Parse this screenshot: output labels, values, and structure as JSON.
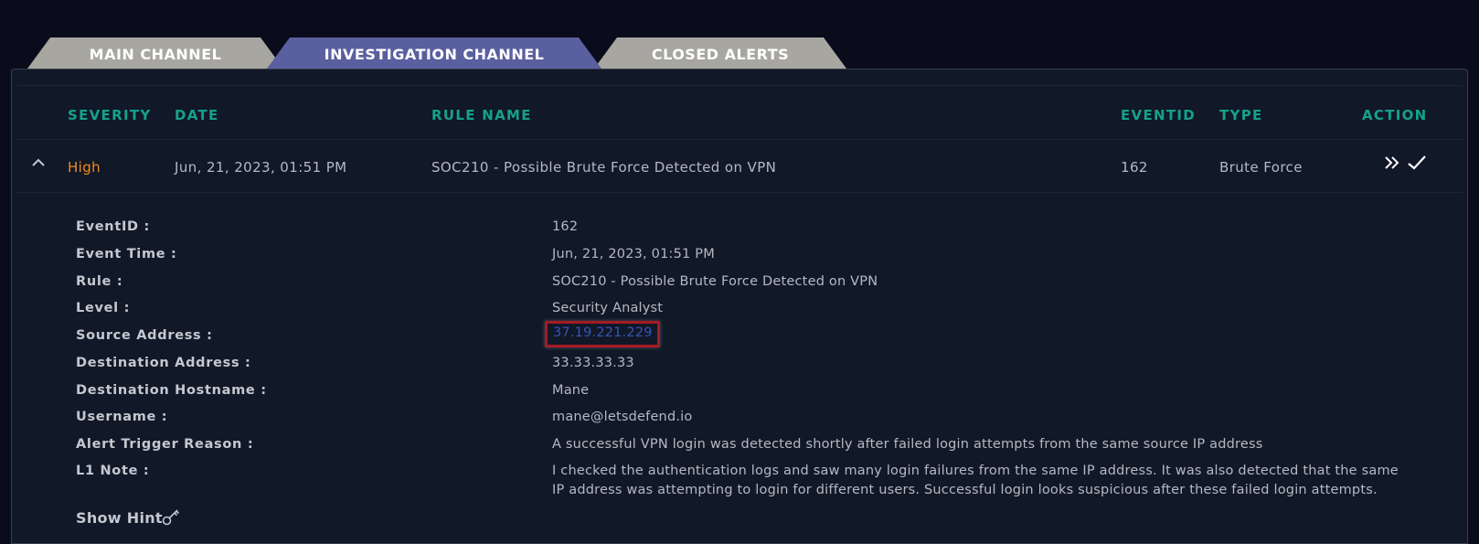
{
  "tabs": [
    {
      "label": "MAIN CHANNEL"
    },
    {
      "label": "INVESTIGATION CHANNEL"
    },
    {
      "label": "CLOSED ALERTS"
    }
  ],
  "columns": {
    "severity": "SEVERITY",
    "date": "DATE",
    "rule_name": "RULE NAME",
    "eventid": "EVENTID",
    "type": "TYPE",
    "action": "ACTION"
  },
  "alert": {
    "severity": "High",
    "date": "Jun, 21, 2023, 01:51 PM",
    "rule_name": "SOC210 - Possible Brute Force Detected on VPN",
    "eventid": "162",
    "type": "Brute Force"
  },
  "details": [
    {
      "label": "EventID :",
      "value": "162"
    },
    {
      "label": "Event Time :",
      "value": "Jun, 21, 2023, 01:51 PM"
    },
    {
      "label": "Rule :",
      "value": "SOC210 - Possible Brute Force Detected on VPN"
    },
    {
      "label": "Level :",
      "value": "Security Analyst"
    },
    {
      "label": "Source Address :",
      "value": "37.19.221.229"
    },
    {
      "label": "Destination Address :",
      "value": "33.33.33.33"
    },
    {
      "label": "Destination Hostname :",
      "value": "Mane"
    },
    {
      "label": "Username :",
      "value": "mane@letsdefend.io"
    },
    {
      "label": "Alert Trigger Reason :",
      "value": "A successful VPN login was detected shortly after failed login attempts from the same source IP address"
    },
    {
      "label": "L1 Note :",
      "value": "I checked the authentication logs and saw many login failures from the same IP address. It was also detected that the same IP address was attempting to login for different users. Successful login looks suspicious after these failed login attempts."
    }
  ],
  "show_hint": "Show Hint",
  "icons": {
    "collapse": "chevron-up-icon",
    "forward": "double-chevron-right-icon",
    "check": "check-icon",
    "hint": "key-icon"
  },
  "colors": {
    "accent_teal": "#14a28c",
    "severity_high": "#f28c1b",
    "active_tab": "#5a5fa0",
    "inactive_tab": "#a8a6a1",
    "highlight_box": "#a71a22",
    "link": "#3653b8"
  }
}
